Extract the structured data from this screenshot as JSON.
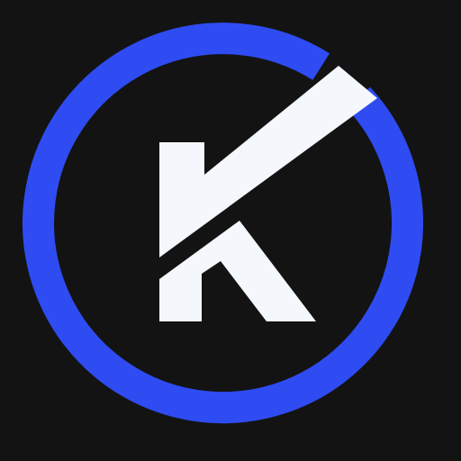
{
  "logo": {
    "letter": "K",
    "icon": "k-letter-in-ring-logo-icon",
    "colors": {
      "background": "#131313",
      "ring": "#2f4cf2",
      "letter": "#f4f7fb"
    }
  }
}
